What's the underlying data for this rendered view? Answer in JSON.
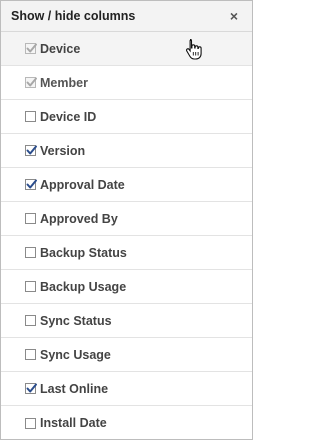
{
  "header": {
    "title": "Show / hide columns",
    "close_symbol": "×"
  },
  "columns": [
    {
      "label": "Device",
      "checked": true,
      "disabled": true
    },
    {
      "label": "Member",
      "checked": true,
      "disabled": true
    },
    {
      "label": "Device ID",
      "checked": false,
      "disabled": false
    },
    {
      "label": "Version",
      "checked": true,
      "disabled": false
    },
    {
      "label": "Approval Date",
      "checked": true,
      "disabled": false
    },
    {
      "label": "Approved By",
      "checked": false,
      "disabled": false
    },
    {
      "label": "Backup Status",
      "checked": false,
      "disabled": false
    },
    {
      "label": "Backup Usage",
      "checked": false,
      "disabled": false
    },
    {
      "label": "Sync Status",
      "checked": false,
      "disabled": false
    },
    {
      "label": "Sync Usage",
      "checked": false,
      "disabled": false
    },
    {
      "label": "Last Online",
      "checked": true,
      "disabled": false
    },
    {
      "label": "Install Date",
      "checked": false,
      "disabled": false
    }
  ],
  "colors": {
    "check_active": "#2b4d8c",
    "check_disabled": "#a8a8a8"
  }
}
